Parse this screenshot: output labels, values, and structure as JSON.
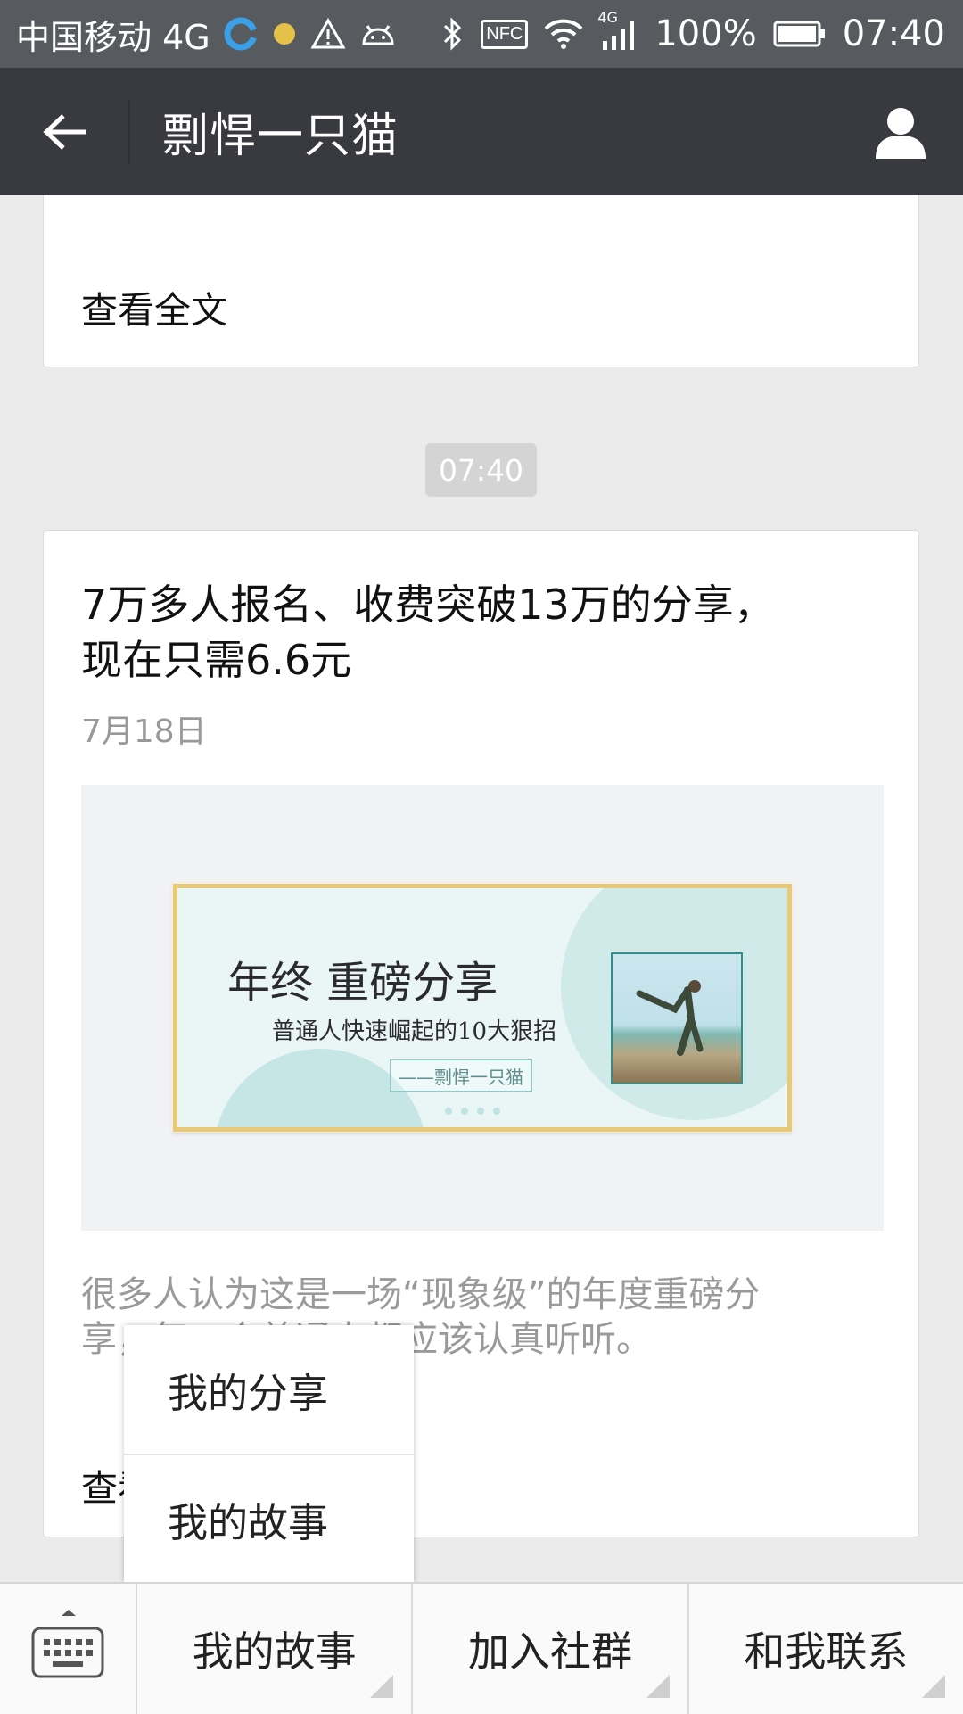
{
  "status_bar": {
    "carrier": "中国移动 4G",
    "battery": "100%",
    "time": "07:40",
    "icons": [
      "browser-icon",
      "dot-icon",
      "warning-icon",
      "android-icon",
      "bluetooth-icon",
      "nfc-icon",
      "wifi-icon",
      "signal-4g-icon",
      "battery-icon"
    ],
    "signal_label": "4G",
    "nfc_label": "NFC"
  },
  "nav": {
    "title": "剽悍一只猫"
  },
  "top_card": {
    "read_more": "查看全文"
  },
  "timestamp": "07:40",
  "article": {
    "title": "7万多人报名、收费突破13万的分享，现在只需6.6元",
    "date": "7月18日",
    "cover": {
      "headline": "年终 重磅分享",
      "subheadline": "普通人快速崛起的10大狠招",
      "tag": "——剽悍一只猫"
    },
    "excerpt": "很多人认为这是一场“现象级”的年度重磅分享，每一个普通人都应该认真听听。",
    "read_more": "查看全文"
  },
  "popup_menu": {
    "items": [
      {
        "label": "我的分享"
      },
      {
        "label": "我的故事"
      }
    ]
  },
  "bottom_menu": {
    "items": [
      {
        "label": "我的故事"
      },
      {
        "label": "加入社群"
      },
      {
        "label": "和我联系"
      }
    ]
  },
  "colors": {
    "status_bar": "#575b60",
    "nav_bar": "#393a3f",
    "background": "#ebebeb",
    "banner_accent": "#e8c975"
  }
}
